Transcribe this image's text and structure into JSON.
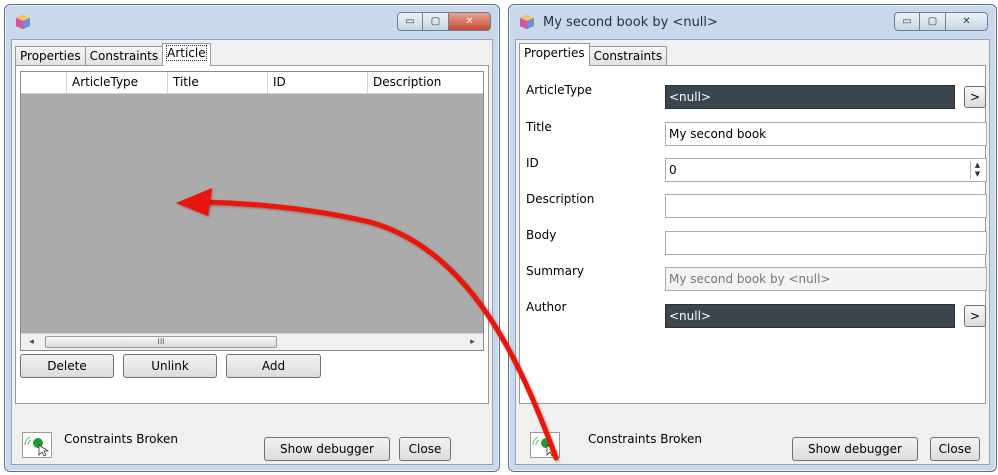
{
  "left_window": {
    "title": "",
    "tabs": [
      "Properties",
      "Constraints",
      "Article"
    ],
    "columns": [
      "ArticleType",
      "Title",
      "ID",
      "Description"
    ],
    "scroll_left": "◂",
    "scroll_right": "▸",
    "scroll_thumb": "III",
    "buttons": {
      "delete": "Delete",
      "unlink": "Unlink",
      "add": "Add"
    },
    "footer": {
      "status": "Constraints Broken",
      "debugger": "Show debugger",
      "close": "Close"
    }
  },
  "right_window": {
    "title": "My second book by <null>",
    "tabs": [
      "Properties",
      "Constraints"
    ],
    "properties": {
      "article_type": {
        "label": "ArticleType",
        "value": "<null>",
        "button": ">"
      },
      "title": {
        "label": "Title",
        "value": "My second book"
      },
      "id": {
        "label": "ID",
        "value": "0"
      },
      "description": {
        "label": "Description",
        "value": ""
      },
      "body": {
        "label": "Body",
        "value": ""
      },
      "summary": {
        "label": "Summary",
        "value": "My second book by <null>"
      },
      "author": {
        "label": "Author",
        "value": "<null>",
        "button": ">"
      }
    },
    "footer": {
      "status": "Constraints Broken",
      "debugger": "Show debugger",
      "close": "Close"
    }
  },
  "window_controls": {
    "minimize": "▭",
    "maximize": "▢",
    "close": "✕"
  },
  "colors": {
    "annotation_arrow": "#e8130f",
    "grid_background": "#ababab",
    "dark_field": "#3c464f"
  }
}
